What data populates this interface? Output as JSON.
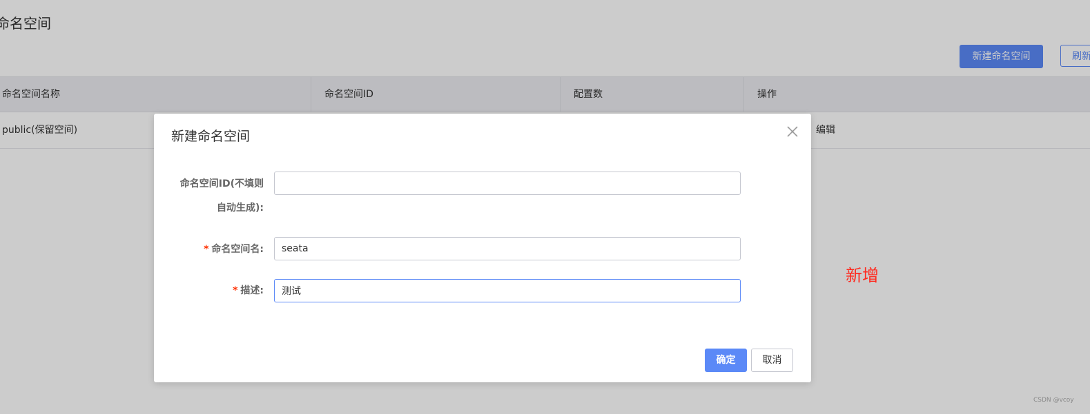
{
  "page": {
    "title": "命名空间",
    "create_button": "新建命名空间",
    "refresh_button": "刷新"
  },
  "table": {
    "columns": [
      "命名空间名称",
      "命名空间ID",
      "配置数",
      "操作"
    ],
    "rows": [
      {
        "name": "public(保留空间)",
        "id": "",
        "count": "",
        "action": "编辑"
      }
    ]
  },
  "dialog": {
    "title": "新建命名空间",
    "fields": {
      "id_label_line1": "命名空间ID(不填则",
      "id_label_line2": "自动生成):",
      "id_value": "",
      "name_required": "*",
      "name_label": "命名空间名:",
      "name_value": "seata",
      "desc_required": "*",
      "desc_label": "描述:",
      "desc_value": "测试"
    },
    "confirm_button": "确定",
    "cancel_button": "取消",
    "close_icon": "close-icon"
  },
  "annotation": "新增",
  "watermark": "CSDN @vcoy",
  "colors": {
    "primary": "#5b89f7",
    "required": "#ff3000",
    "annotation": "#ff2a1f"
  }
}
